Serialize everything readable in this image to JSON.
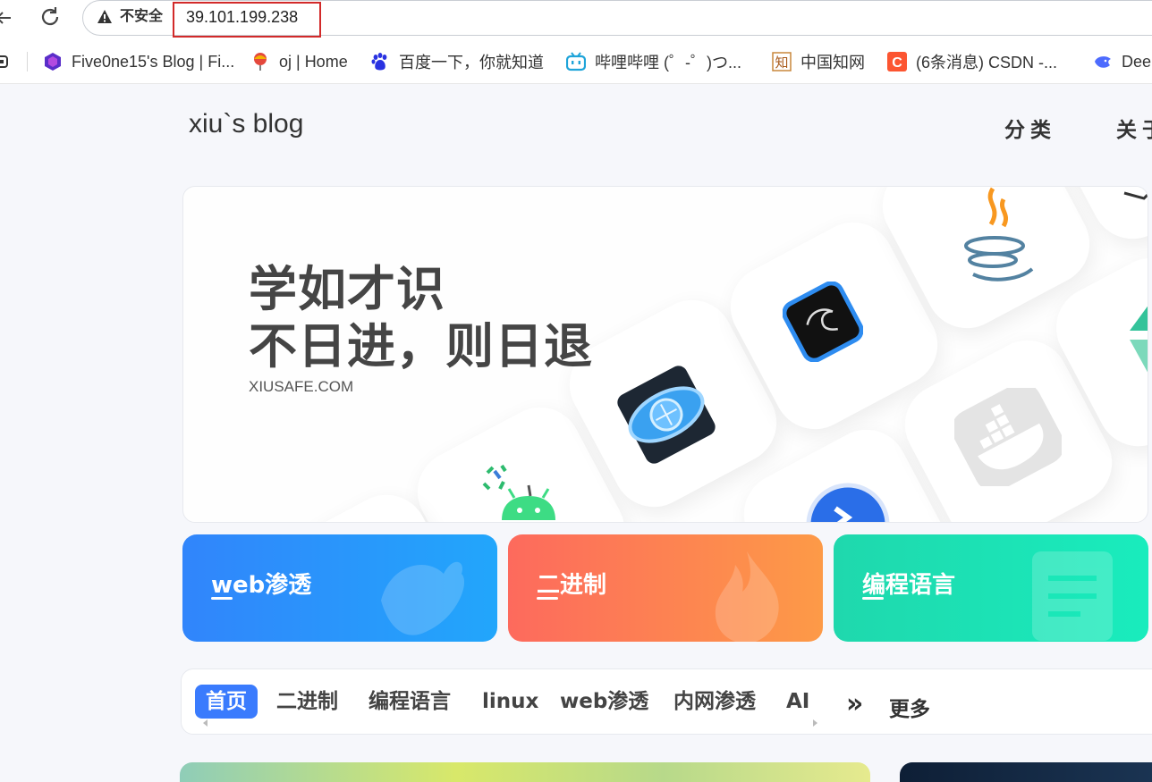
{
  "browser": {
    "security_label": "不安全",
    "url": "39.101.199.238",
    "bookmarks": [
      {
        "label": "Five0ne15's Blog | Fi...",
        "icon": "hexagon-logo-icon"
      },
      {
        "label": "oj | Home",
        "icon": "balloon-logo-icon"
      },
      {
        "label": "百度一下，你就知道",
        "icon": "baidu-paw-icon"
      },
      {
        "label": "哔哩哔哩 (゜-゜)つ...",
        "icon": "bilibili-tv-icon"
      },
      {
        "label": "中国知网",
        "icon": "cnki-logo-icon"
      },
      {
        "label": "(6条消息) CSDN -...",
        "icon": "csdn-logo-icon"
      },
      {
        "label": "Dee",
        "icon": "deepseek-whale-icon"
      }
    ]
  },
  "header": {
    "site_title": "xiu`s blog",
    "nav": [
      "分类",
      "关于"
    ]
  },
  "hero": {
    "line1": "学如才识",
    "line2": "不日进，则日退",
    "subtitle": "XIUSAFE.COM"
  },
  "categories": [
    {
      "label": "web渗透",
      "gradient": [
        "#3185fb",
        "#22a6fb"
      ]
    },
    {
      "label": "二进制",
      "gradient": [
        "#fd6a5d",
        "#fd9a47"
      ]
    },
    {
      "label": "编程语言",
      "gradient": [
        "#1fd8ad",
        "#19ecbd"
      ]
    }
  ],
  "tabs": {
    "items": [
      "首页",
      "二进制",
      "编程语言",
      "linux",
      "web渗透",
      "内网渗透",
      "AI"
    ],
    "active_index": 0,
    "more_icon": "»",
    "more_label": "更多"
  },
  "colors": {
    "accent": "#3a7bfd",
    "url_highlight": "#d22a2a"
  }
}
